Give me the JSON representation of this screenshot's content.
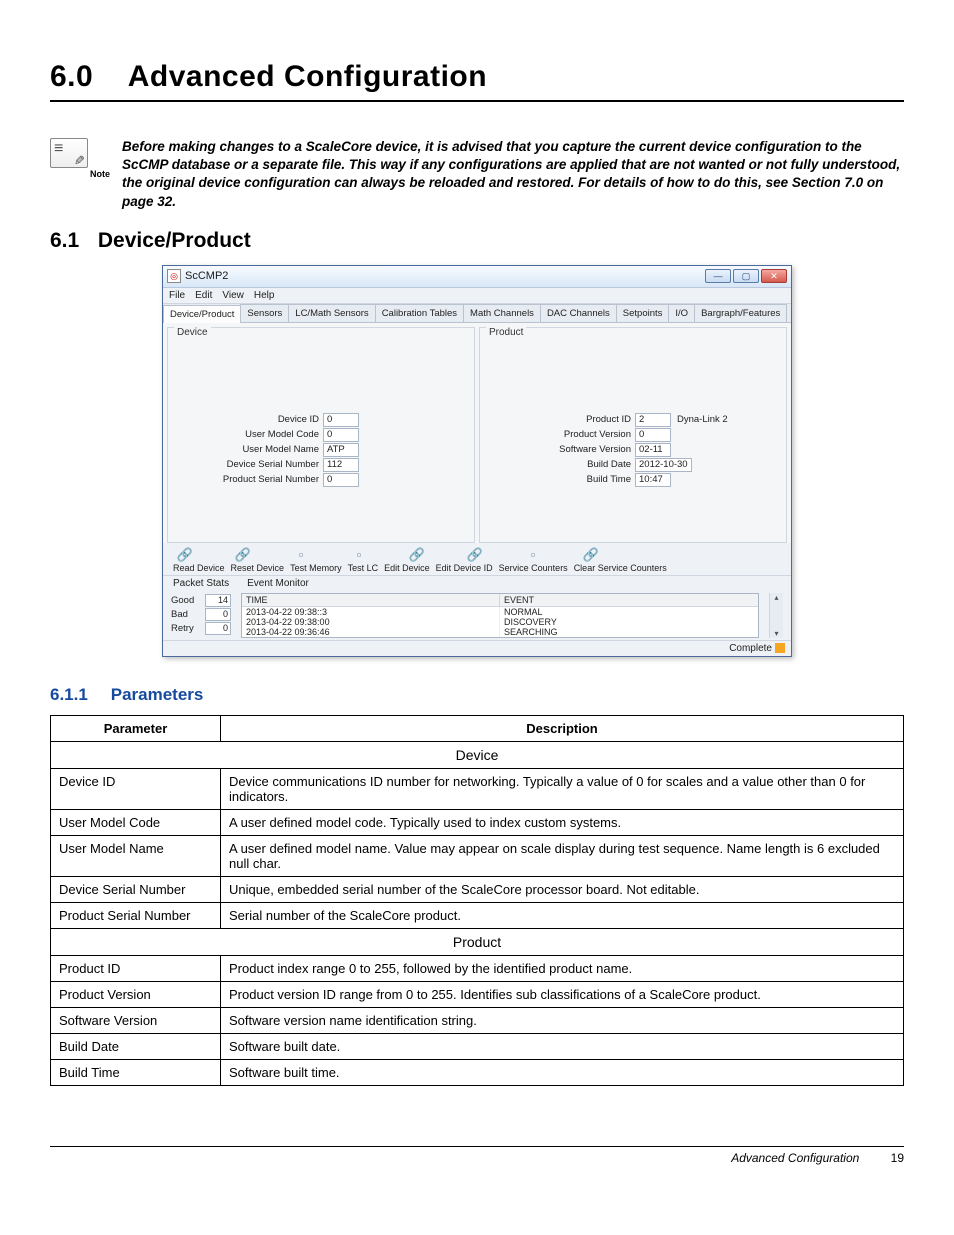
{
  "chapter": {
    "num": "6.0",
    "title": "Advanced Configuration"
  },
  "note": {
    "label": "Note",
    "text": "Before making changes to a ScaleCore device, it is advised that you capture the current device configuration to the ScCMP database or a separate file. This way if any configurations are applied that are not wanted or not fully understood, the original device configuration can always be reloaded and restored. For details of how to do this, see Section 7.0 on page 32."
  },
  "section": {
    "num": "6.1",
    "title": "Device/Product"
  },
  "screenshot": {
    "app_title": "ScCMP2",
    "menus": [
      "File",
      "Edit",
      "View",
      "Help"
    ],
    "tabs": [
      "Device/Product",
      "Sensors",
      "LC/Math Sensors",
      "Calibration Tables",
      "Math Channels",
      "DAC Channels",
      "Setpoints",
      "I/O",
      "Bargraph/Features"
    ],
    "device_pane": {
      "title": "Device",
      "fields": [
        {
          "label": "Device ID",
          "value": "0"
        },
        {
          "label": "User Model Code",
          "value": "0"
        },
        {
          "label": "User Model Name",
          "value": "ATP"
        },
        {
          "label": "Device Serial Number",
          "value": "112"
        },
        {
          "label": "Product Serial Number",
          "value": "0"
        }
      ]
    },
    "product_pane": {
      "title": "Product",
      "fields": [
        {
          "label": "Product ID",
          "value": "2",
          "extra": "Dyna-Link 2"
        },
        {
          "label": "Product Version",
          "value": "0"
        },
        {
          "label": "Software Version",
          "value": "02-11"
        },
        {
          "label": "Build Date",
          "value": "2012-10-30"
        },
        {
          "label": "Build Time",
          "value": "10:47"
        }
      ]
    },
    "tool_labels": [
      "Read Device",
      "Reset Device",
      "Test Memory",
      "Test LC",
      "Edit Device",
      "Edit Device ID",
      "Service Counters",
      "Clear Service Counters"
    ],
    "lower_tabs": {
      "left": "Packet Stats",
      "right": "Event Monitor"
    },
    "stats": [
      {
        "label": "Good",
        "value": "14"
      },
      {
        "label": "Bad",
        "value": "0"
      },
      {
        "label": "Retry",
        "value": "0"
      }
    ],
    "event_headers": {
      "time": "TIME",
      "event": "EVENT"
    },
    "events": [
      {
        "time": "2013-04-22 09:38::3",
        "event": "NORMAL"
      },
      {
        "time": "2013-04-22 09:38:00",
        "event": "DISCOVERY"
      },
      {
        "time": "2013-04-22 09:36:46",
        "event": "SEARCHING"
      }
    ],
    "status": "Complete"
  },
  "subsection": {
    "num": "6.1.1",
    "title": "Parameters"
  },
  "param_table": {
    "headers": {
      "param": "Parameter",
      "desc": "Description"
    },
    "groups": [
      {
        "group": "Device",
        "rows": [
          {
            "p": "Device ID",
            "d": "Device communications ID number for networking. Typically a value of 0 for scales and a value other than 0 for indicators."
          },
          {
            "p": "User Model Code",
            "d": "A user defined model code. Typically used to index custom systems."
          },
          {
            "p": "User Model Name",
            "d": "A user defined model name. Value may appear on scale display during test sequence. Name length is 6 excluded null char."
          },
          {
            "p": "Device Serial Number",
            "d": "Unique, embedded serial number of the ScaleCore processor board. Not editable."
          },
          {
            "p": "Product Serial Number",
            "d": "Serial number of the ScaleCore product."
          }
        ]
      },
      {
        "group": "Product",
        "rows": [
          {
            "p": "Product ID",
            "d": "Product index range 0 to 255, followed by the identified product name."
          },
          {
            "p": "Product Version",
            "d": "Product version ID range from 0 to 255. Identifies sub classifications of a ScaleCore product."
          },
          {
            "p": "Software Version",
            "d": "Software version name identification string."
          },
          {
            "p": "Build Date",
            "d": "Software built date."
          },
          {
            "p": "Build Time",
            "d": "Software built time."
          }
        ]
      }
    ]
  },
  "footer": {
    "title": "Advanced Configuration",
    "page": "19"
  }
}
